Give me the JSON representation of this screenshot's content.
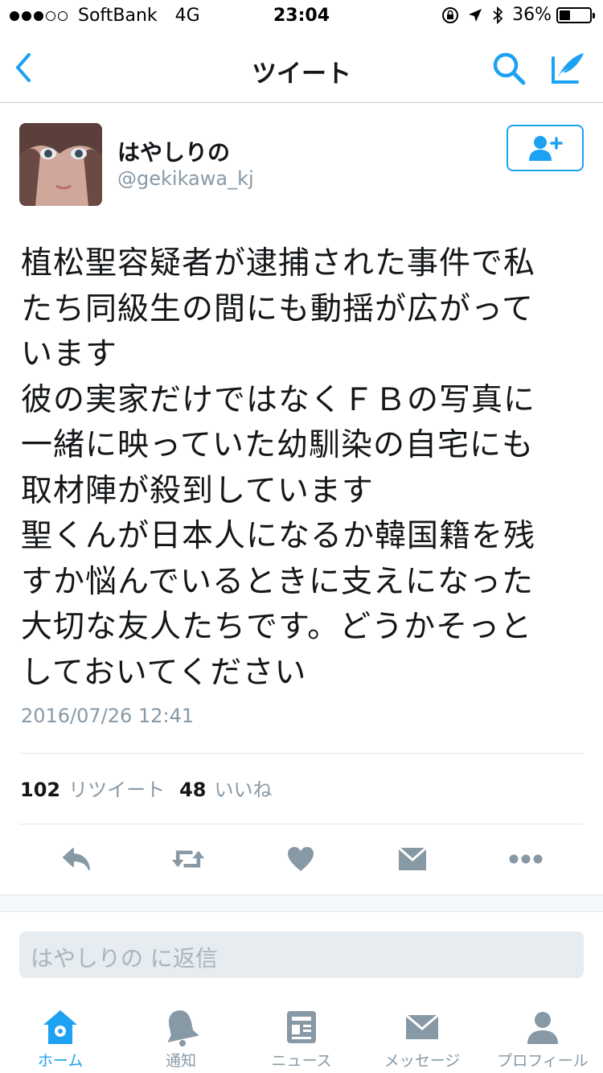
{
  "status_bar": {
    "carrier": "SoftBank",
    "network": "4G",
    "time": "23:04",
    "battery": "36%",
    "battery_level": 0.36
  },
  "nav": {
    "title": "ツイート",
    "back_icon": "chevron-left-icon",
    "search_icon": "search-icon",
    "compose_icon": "compose-quill-icon"
  },
  "tweet": {
    "author_name": "はやしりの",
    "author_handle": "@gekikawa_kj",
    "follow_icon": "add-user-icon",
    "text": "植松聖容疑者が逮捕された事件で私\nたち同級生の間にも動揺が広がって\nいます\n彼の実家だけではなくＦＢの写真に\n一緒に映っていた幼馴染の自宅にも\n取材陣が殺到しています\n聖くんが日本人になるか韓国籍を残\nすか悩んでいるときに支えになった\n大切な友人たちです。どうかそっと\nしておいてください",
    "timestamp": "2016/07/26 12:41",
    "retweet_count": "102",
    "retweet_label": "リツイート",
    "like_count": "48",
    "like_label": "いいね"
  },
  "actions": [
    "reply-icon",
    "retweet-icon",
    "heart-icon",
    "dm-envelope-icon",
    "more-icon"
  ],
  "reply": {
    "placeholder": "はやしりの に返信"
  },
  "tabs": [
    {
      "label": "ホーム",
      "icon": "home-icon",
      "active": true
    },
    {
      "label": "通知",
      "icon": "bell-icon",
      "active": false
    },
    {
      "label": "ニュース",
      "icon": "news-icon",
      "active": false
    },
    {
      "label": "メッセージ",
      "icon": "envelope-icon",
      "active": false
    },
    {
      "label": "プロフィール",
      "icon": "profile-icon",
      "active": false
    }
  ],
  "colors": {
    "accent": "#1da1f2",
    "muted": "#8899a6",
    "action_icon": "#8899a6"
  }
}
